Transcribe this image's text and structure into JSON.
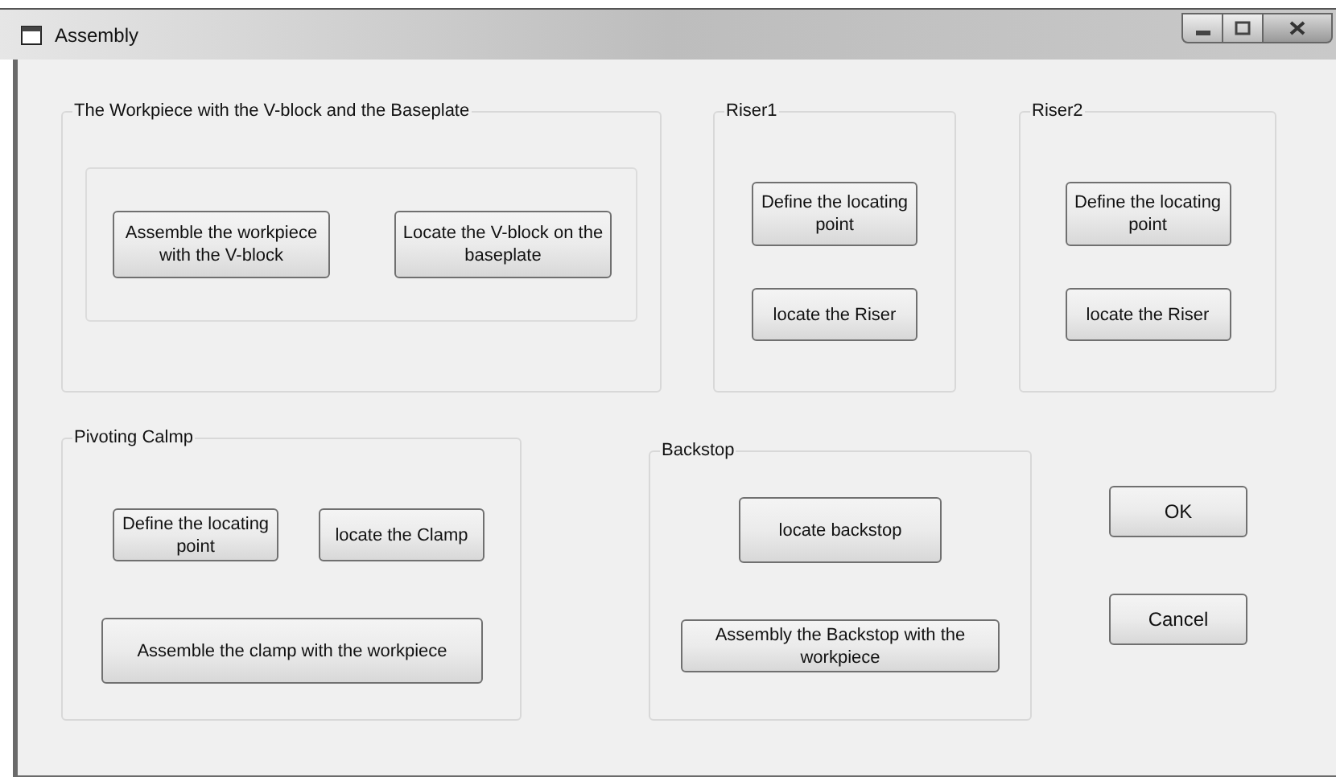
{
  "window": {
    "title": "Assembly"
  },
  "workpiece_group": {
    "title": "The Workpiece with the V-block and the Baseplate",
    "buttons": [
      "Assemble the workpiece with the V-block",
      "Locate the V-block on the baseplate"
    ]
  },
  "riser_groups": [
    {
      "title": "Riser1",
      "buttons": [
        "Define the locating point",
        "locate the Riser"
      ]
    },
    {
      "title": "Riser2",
      "buttons": [
        "Define the locating point",
        "locate the Riser"
      ]
    }
  ],
  "pivoting_clamp_group": {
    "title": "Pivoting Calmp",
    "buttons": [
      "Define the locating point",
      "locate the Clamp",
      "Assemble the clamp with the workpiece"
    ]
  },
  "backstop_group": {
    "title": "Backstop",
    "buttons": [
      "locate backstop",
      "Assembly the Backstop with the workpiece"
    ]
  },
  "dialog_buttons": [
    "OK",
    "Cancel"
  ]
}
